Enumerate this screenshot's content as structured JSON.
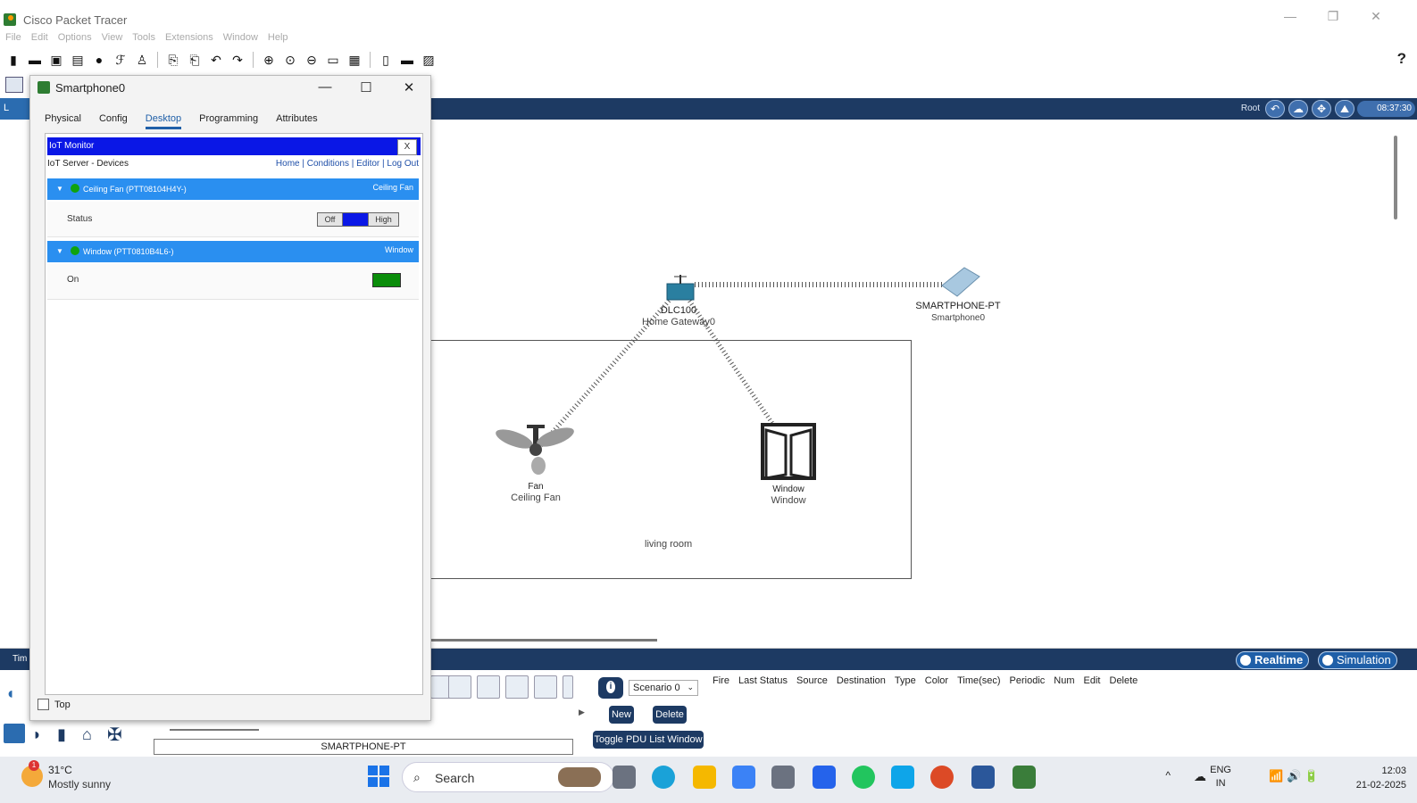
{
  "app": {
    "title": "Cisco Packet Tracer"
  },
  "menu": [
    "File",
    "Edit",
    "Options",
    "View",
    "Tools",
    "Extensions",
    "Window",
    "Help"
  ],
  "toolbar": {
    "help": "?"
  },
  "workspace": {
    "root_label": "Root",
    "clock": "08:37:30",
    "logical_tab": "L"
  },
  "dialog": {
    "title": "Smartphone0",
    "tabs": [
      "Physical",
      "Config",
      "Desktop",
      "Programming",
      "Attributes"
    ],
    "active_tab": "Desktop",
    "iot_monitor": {
      "header": "IoT Monitor",
      "close": "X",
      "breadcrumb": "IoT Server - Devices",
      "nav_links": "Home | Conditions | Editor | Log Out",
      "devices": [
        {
          "name": "Ceiling Fan (PTT08104H4Y-)",
          "type": "Ceiling Fan",
          "prop_label": "Status",
          "state_off": "Off",
          "state_high": "High"
        },
        {
          "name": "Window (PTT0810B4L6-)",
          "type": "Window",
          "prop_label": "On"
        }
      ]
    },
    "top_checkbox": "Top"
  },
  "canvas": {
    "devices": [
      {
        "model": "DLC100",
        "name": "Home Gateway0"
      },
      {
        "model": "SMARTPHONE-PT",
        "name": "Smartphone0"
      },
      {
        "model": "Fan",
        "name": "Ceiling Fan"
      },
      {
        "model": "Window",
        "name": "Window"
      }
    ],
    "room_label": "living room"
  },
  "bottom": {
    "time_label": "Tim",
    "realtime": "Realtime",
    "simulation": "Simulation",
    "scenario": "Scenario 0",
    "new_btn": "New",
    "delete_btn": "Delete",
    "toggle_btn": "Toggle PDU List Window",
    "pdu_columns": [
      "Fire",
      "Last Status",
      "Source",
      "Destination",
      "Type",
      "Color",
      "Time(sec)",
      "Periodic",
      "Num",
      "Edit",
      "Delete"
    ],
    "selected_device": "SMARTPHONE-PT"
  },
  "taskbar": {
    "temp": "31°C",
    "weather": "Mostly sunny",
    "weather_badge": "1",
    "search": "Search",
    "lang_top": "ENG",
    "lang_bottom": "IN",
    "time": "12:03",
    "date": "21-02-2025"
  }
}
